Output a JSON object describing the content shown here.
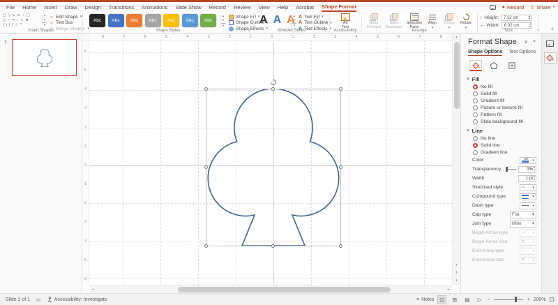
{
  "app": {
    "record_label": "Record",
    "share_label": "Share"
  },
  "menu": {
    "tabs": [
      "File",
      "Home",
      "Insert",
      "Draw",
      "Design",
      "Transitions",
      "Animations",
      "Slide Show",
      "Record",
      "Review",
      "View",
      "Help",
      "Acrobat"
    ],
    "active_tab": "Shape Format"
  },
  "ribbon": {
    "insert_shapes": {
      "label": "Insert Shapes",
      "edit_shape": "Edit Shape",
      "text_box": "Text Box",
      "merge_shapes": "Merge Shapes"
    },
    "shape_styles": {
      "label": "Shape Styles",
      "swatches": [
        {
          "label": "Abc",
          "color": "#262626"
        },
        {
          "label": "Abc",
          "color": "#4472C4"
        },
        {
          "label": "Abc",
          "color": "#ED7D31"
        },
        {
          "label": "Abc",
          "color": "#A5A5A5"
        },
        {
          "label": "Abc",
          "color": "#FFC000"
        },
        {
          "label": "Abc",
          "color": "#5B9BD5"
        },
        {
          "label": "Abc",
          "color": "#70AD47"
        }
      ],
      "fill": "Shape Fill",
      "outline": "Shape Outline",
      "effects": "Shape Effects"
    },
    "wordart": {
      "label": "WordArt Styles",
      "letter": "A",
      "fill": "Text Fill",
      "outline": "Text Outline",
      "effects": "Text Effects"
    },
    "accessibility": {
      "label": "Accessibility",
      "alt_text": "Alt Text"
    },
    "arrange": {
      "label": "Arrange",
      "buttons": [
        "Bring Forward",
        "Send Backward",
        "Selection Pane",
        "Align",
        "Group",
        "Rotate"
      ]
    },
    "size": {
      "label": "Size",
      "height_label": "Height:",
      "height_value": "7.12 cm",
      "width_label": "Width:",
      "width_value": "6.02 cm"
    }
  },
  "thumbnails": {
    "slide_number": "1"
  },
  "canvas": {
    "h_ruler": [
      "8",
      "7",
      "6",
      "5",
      "4",
      "3",
      "2",
      "1",
      "0",
      "1",
      "2",
      "3",
      "4",
      "5",
      "6",
      "7",
      "8"
    ],
    "v_ruler": [
      "6",
      "5",
      "4",
      "3",
      "2",
      "1",
      "0",
      "1",
      "2",
      "3",
      "4",
      "5",
      "6"
    ],
    "shape_stroke": "#3E6294"
  },
  "format_pane": {
    "title": "Format Shape",
    "tab_shape": "Shape Options",
    "tab_text": "Text Options",
    "fill_header": "Fill",
    "fill_options": [
      "No fill",
      "Solid fill",
      "Gradient fill",
      "Picture or texture fill",
      "Pattern fill",
      "Slide background fill"
    ],
    "line_header": "Line",
    "line_options": [
      "No line",
      "Solid line",
      "Gradient line"
    ],
    "rows": [
      {
        "label": "Color"
      },
      {
        "label": "Transparency",
        "value": "0%"
      },
      {
        "label": "Width",
        "value": "1 pt"
      },
      {
        "label": "Sketched style"
      },
      {
        "label": "Compound type"
      },
      {
        "label": "Dash type"
      },
      {
        "label": "Cap type",
        "value": "Flat"
      },
      {
        "label": "Join type",
        "value": "Miter"
      },
      {
        "label": "Begin Arrow type"
      },
      {
        "label": "Begin Arrow size"
      },
      {
        "label": "End Arrow type"
      },
      {
        "label": "End Arrow size"
      }
    ]
  },
  "statusbar": {
    "slide_info": "Slide 1 of 1",
    "accessibility": "Accessibility: Investigate",
    "notes": "Notes",
    "zoom": "200%"
  },
  "icons": {
    "dropdown": "▾",
    "spin_up": "▴",
    "spin_down": "▾",
    "more": "▾",
    "section_chevron": "∨",
    "pane_chevron": "∨",
    "pane_close": "×",
    "scroll_up": "▴",
    "scroll_down": "▾",
    "scroll_left": "◂",
    "scroll_right": "▸",
    "prev_slide": "↟",
    "next_slide": "↡",
    "height": "↕",
    "width": "↔",
    "notes": "≡",
    "view_normal": "◫",
    "view_sorter": "⊞",
    "view_reading": "▤",
    "view_slideshow": "▷",
    "fit_window": "⊡",
    "display_settings": "▭",
    "share": "⇧",
    "record_dot": "●",
    "zoom_minus": "−",
    "zoom_plus": "+",
    "gallery_row1": "◻ ╲ ↘ ▭ ○ ▢",
    "gallery_row2": "△ ~ ⇒ ↓ ☆ ★",
    "gallery_row3": "( ) { } ☆ *",
    "edit_shape": "▱",
    "text_box": "▭",
    "merge_shapes": "◎",
    "launcher": "⇘",
    "collapse": "∧",
    "arrow_left": "←",
    "arrow_right": "→",
    "bars": "≡"
  },
  "colors": {
    "accent": "#B7472A",
    "selection": "#C8412B"
  }
}
